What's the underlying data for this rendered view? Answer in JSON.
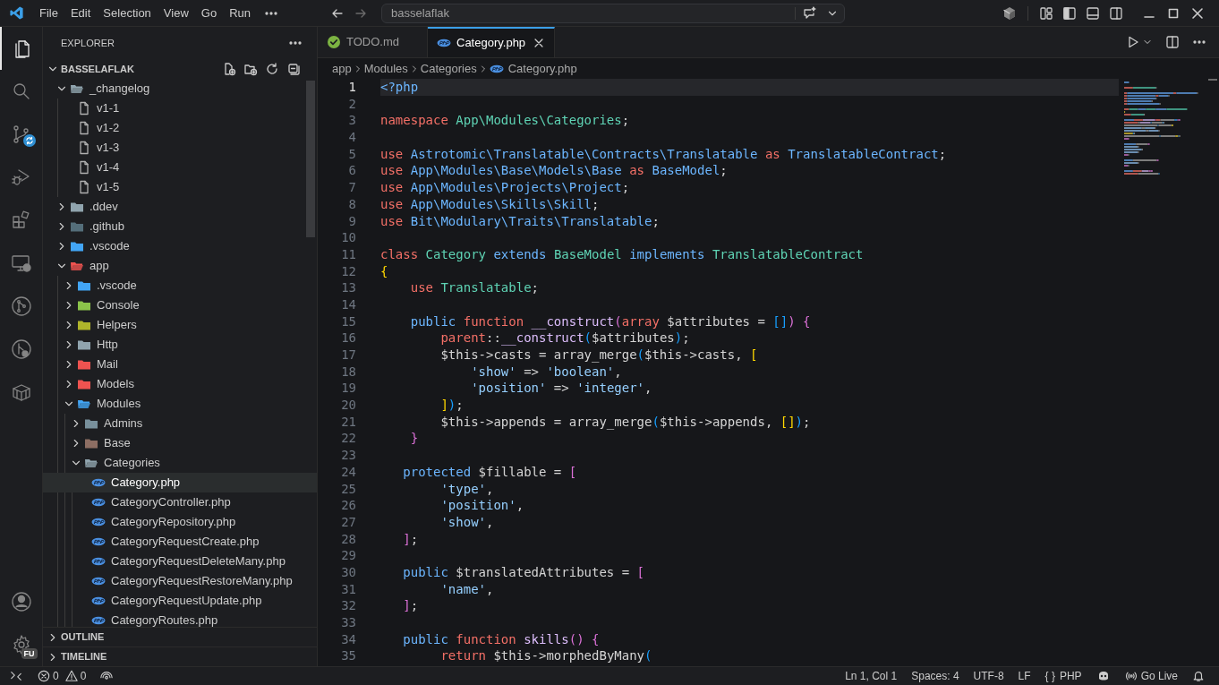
{
  "title_bar": {
    "menu": [
      "File",
      "Edit",
      "Selection",
      "View",
      "Go",
      "Run"
    ],
    "command_center": "basselaflak"
  },
  "activity_bar": {
    "items": [
      {
        "kind": "explorer",
        "selected": true
      },
      {
        "kind": "search",
        "selected": false
      },
      {
        "kind": "source-control",
        "selected": false
      },
      {
        "kind": "debug",
        "selected": false
      },
      {
        "kind": "extensions",
        "selected": false
      },
      {
        "kind": "remote",
        "selected": false
      },
      {
        "kind": "git-graph",
        "selected": false
      },
      {
        "kind": "git-tools",
        "selected": false
      },
      {
        "kind": "containers",
        "selected": false
      }
    ],
    "settings_badge": "FU"
  },
  "sidebar": {
    "title": "EXPLORER",
    "root": {
      "label": "BASSELAFLAK",
      "expanded": true
    },
    "tree": [
      {
        "label": "_changelog",
        "kind": "folder",
        "color": "#90a4ae",
        "expanded": true,
        "selected": false,
        "children": [
          {
            "label": "v1-1",
            "kind": "file",
            "selected": false
          },
          {
            "label": "v1-2",
            "kind": "file",
            "selected": false
          },
          {
            "label": "v1-3",
            "kind": "file",
            "selected": false
          },
          {
            "label": "v1-4",
            "kind": "file",
            "selected": false
          },
          {
            "label": "v1-5",
            "kind": "file",
            "selected": false
          }
        ]
      },
      {
        "label": ".ddev",
        "kind": "folder",
        "color": "#90a4ae",
        "expanded": false,
        "selected": false
      },
      {
        "label": ".github",
        "kind": "folder",
        "color": "#546e7a",
        "expanded": false,
        "selected": false
      },
      {
        "label": ".vscode",
        "kind": "folder",
        "color": "#42a5f5",
        "expanded": false,
        "selected": false
      },
      {
        "label": "app",
        "kind": "folder",
        "color": "#ef5350",
        "expanded": true,
        "selected": false,
        "children": [
          {
            "label": ".vscode",
            "kind": "folder",
            "color": "#42a5f5",
            "expanded": false,
            "selected": false
          },
          {
            "label": "Console",
            "kind": "folder",
            "color": "#8bc34a",
            "expanded": false,
            "selected": false
          },
          {
            "label": "Helpers",
            "kind": "folder",
            "color": "#afb42b",
            "expanded": false,
            "selected": false
          },
          {
            "label": "Http",
            "kind": "folder",
            "color": "#90a4ae",
            "expanded": false,
            "selected": false
          },
          {
            "label": "Mail",
            "kind": "folder",
            "color": "#ef5350",
            "expanded": false,
            "selected": false
          },
          {
            "label": "Models",
            "kind": "folder",
            "color": "#ef5350",
            "expanded": false,
            "selected": false
          },
          {
            "label": "Modules",
            "kind": "folder",
            "color": "#42a5f5",
            "expanded": true,
            "selected": false,
            "children": [
              {
                "label": "Admins",
                "kind": "folder",
                "color": "#78909c",
                "expanded": false,
                "selected": false
              },
              {
                "label": "Base",
                "kind": "folder",
                "color": "#8d6e63",
                "expanded": false,
                "selected": false
              },
              {
                "label": "Categories",
                "kind": "folder",
                "color": "#90a4ae",
                "expanded": true,
                "selected": false,
                "children": [
                  {
                    "label": "Category.php",
                    "kind": "php",
                    "selected": true
                  },
                  {
                    "label": "CategoryController.php",
                    "kind": "php",
                    "selected": false
                  },
                  {
                    "label": "CategoryRepository.php",
                    "kind": "php",
                    "selected": false
                  },
                  {
                    "label": "CategoryRequestCreate.php",
                    "kind": "php",
                    "selected": false
                  },
                  {
                    "label": "CategoryRequestDeleteMany.php",
                    "kind": "php",
                    "selected": false
                  },
                  {
                    "label": "CategoryRequestRestoreMany.php",
                    "kind": "php",
                    "selected": false
                  },
                  {
                    "label": "CategoryRequestUpdate.php",
                    "kind": "php",
                    "selected": false
                  },
                  {
                    "label": "CategoryRoutes.php",
                    "kind": "php",
                    "selected": false
                  }
                ]
              }
            ]
          }
        ]
      }
    ],
    "sections": [
      {
        "label": "OUTLINE",
        "expanded": false
      },
      {
        "label": "TIMELINE",
        "expanded": false
      }
    ]
  },
  "tabs": [
    {
      "label": "TODO.md",
      "kind": "markdown",
      "selected": false
    },
    {
      "label": "Category.php",
      "kind": "php",
      "selected": true
    }
  ],
  "breadcrumbs": [
    {
      "label": "app",
      "kind": "folder"
    },
    {
      "label": "Modules",
      "kind": "folder"
    },
    {
      "label": "Categories",
      "kind": "folder"
    },
    {
      "label": "Category.php",
      "kind": "php"
    }
  ],
  "editor": {
    "lines": [
      {
        "number": "1",
        "current": true,
        "tokens": [
          {
            "kind": "tag",
            "text": "<?php"
          }
        ]
      },
      {
        "number": "2",
        "current": false
      },
      {
        "number": "3",
        "current": false,
        "tokens": [
          {
            "kind": "kw",
            "text": "namespace"
          },
          {
            "kind": "ns",
            "text": " App\\Modules\\Categories"
          },
          {
            "kind": "plain",
            "text": ";"
          }
        ]
      },
      {
        "number": "4",
        "current": false
      },
      {
        "number": "5",
        "current": false,
        "tokens": [
          {
            "kind": "kw",
            "text": "use"
          },
          {
            "kind": "path",
            "text": " Astrotomic\\Translatable\\Contracts\\Translatable"
          },
          {
            "kind": "kw",
            "text": " as"
          },
          {
            "kind": "path",
            "text": " TranslatableContract"
          },
          {
            "kind": "plain",
            "text": ";"
          }
        ]
      },
      {
        "number": "6",
        "current": false,
        "tokens": [
          {
            "kind": "kw",
            "text": "use"
          },
          {
            "kind": "path",
            "text": " App\\Modules\\Base\\Models\\Base"
          },
          {
            "kind": "kw",
            "text": " as"
          },
          {
            "kind": "path",
            "text": " BaseModel"
          },
          {
            "kind": "plain",
            "text": ";"
          }
        ]
      },
      {
        "number": "7",
        "current": false,
        "tokens": [
          {
            "kind": "kw",
            "text": "use"
          },
          {
            "kind": "path",
            "text": " App\\Modules\\Projects\\Project"
          },
          {
            "kind": "plain",
            "text": ";"
          }
        ]
      },
      {
        "number": "8",
        "current": false,
        "tokens": [
          {
            "kind": "kw",
            "text": "use"
          },
          {
            "kind": "path",
            "text": " App\\Modules\\Skills\\Skill"
          },
          {
            "kind": "plain",
            "text": ";"
          }
        ]
      },
      {
        "number": "9",
        "current": false,
        "tokens": [
          {
            "kind": "kw",
            "text": "use"
          },
          {
            "kind": "path",
            "text": " Bit\\Modulary\\Traits\\Translatable"
          },
          {
            "kind": "plain",
            "text": ";"
          }
        ]
      },
      {
        "number": "10",
        "current": false
      },
      {
        "number": "11",
        "current": false,
        "tokens": [
          {
            "kind": "kw",
            "text": "class"
          },
          {
            "kind": "type",
            "text": " Category"
          },
          {
            "kind": "mod",
            "text": " extends"
          },
          {
            "kind": "type",
            "text": " BaseModel"
          },
          {
            "kind": "mod",
            "text": " implements"
          },
          {
            "kind": "type",
            "text": " TranslatableContract"
          }
        ]
      },
      {
        "number": "12",
        "current": false,
        "tokens": [
          {
            "kind": "b1",
            "text": "{"
          }
        ]
      },
      {
        "number": "13",
        "current": false,
        "tokens": [
          {
            "kind": "kw",
            "text": "    use"
          },
          {
            "kind": "type",
            "text": " Translatable"
          },
          {
            "kind": "plain",
            "text": ";"
          }
        ]
      },
      {
        "number": "14",
        "current": false
      },
      {
        "number": "15",
        "current": false,
        "tokens": [
          {
            "kind": "mod",
            "text": "    public"
          },
          {
            "kind": "kw",
            "text": " function"
          },
          {
            "kind": "fn",
            "text": " __construct"
          },
          {
            "kind": "b2",
            "text": "("
          },
          {
            "kind": "kw",
            "text": "array"
          },
          {
            "kind": "plain",
            "text": " $attributes ="
          },
          {
            "kind": "b3",
            "text": " []"
          },
          {
            "kind": "b2",
            "text": ")"
          },
          {
            "kind": "b2",
            "text": " {"
          }
        ]
      },
      {
        "number": "16",
        "current": false,
        "tokens": [
          {
            "kind": "kw",
            "text": "        parent"
          },
          {
            "kind": "plain",
            "text": "::"
          },
          {
            "kind": "fn",
            "text": "__construct"
          },
          {
            "kind": "b3",
            "text": "("
          },
          {
            "kind": "plain",
            "text": "$attributes"
          },
          {
            "kind": "b3",
            "text": ")"
          },
          {
            "kind": "plain",
            "text": ";"
          }
        ]
      },
      {
        "number": "17",
        "current": false,
        "tokens": [
          {
            "kind": "plain",
            "text": "        $this->casts = array_merge"
          },
          {
            "kind": "b3",
            "text": "("
          },
          {
            "kind": "plain",
            "text": "$this->casts,"
          },
          {
            "kind": "b1",
            "text": " ["
          }
        ]
      },
      {
        "number": "18",
        "current": false,
        "tokens": [
          {
            "kind": "str",
            "text": "            'show'"
          },
          {
            "kind": "plain",
            "text": " =>"
          },
          {
            "kind": "str",
            "text": " 'boolean'"
          },
          {
            "kind": "plain",
            "text": ","
          }
        ]
      },
      {
        "number": "19",
        "current": false,
        "tokens": [
          {
            "kind": "str",
            "text": "            'position'"
          },
          {
            "kind": "plain",
            "text": " =>"
          },
          {
            "kind": "str",
            "text": " 'integer'"
          },
          {
            "kind": "plain",
            "text": ","
          }
        ]
      },
      {
        "number": "20",
        "current": false,
        "tokens": [
          {
            "kind": "b1",
            "text": "        ]"
          },
          {
            "kind": "b3",
            "text": ")"
          },
          {
            "kind": "plain",
            "text": ";"
          }
        ]
      },
      {
        "number": "21",
        "current": false,
        "tokens": [
          {
            "kind": "plain",
            "text": "        $this->appends = array_merge"
          },
          {
            "kind": "b3",
            "text": "("
          },
          {
            "kind": "plain",
            "text": "$this->appends,"
          },
          {
            "kind": "b1",
            "text": " []"
          },
          {
            "kind": "b3",
            "text": ")"
          },
          {
            "kind": "plain",
            "text": ";"
          }
        ]
      },
      {
        "number": "22",
        "current": false,
        "tokens": [
          {
            "kind": "b2",
            "text": "    }"
          }
        ]
      },
      {
        "number": "23",
        "current": false
      },
      {
        "number": "24",
        "current": false,
        "tokens": [
          {
            "kind": "mod",
            "text": "   protected"
          },
          {
            "kind": "plain",
            "text": " $fillable ="
          },
          {
            "kind": "b2",
            "text": " ["
          }
        ]
      },
      {
        "number": "25",
        "current": false,
        "tokens": [
          {
            "kind": "str",
            "text": "        'type'"
          },
          {
            "kind": "plain",
            "text": ","
          }
        ]
      },
      {
        "number": "26",
        "current": false,
        "tokens": [
          {
            "kind": "str",
            "text": "        'position'"
          },
          {
            "kind": "plain",
            "text": ","
          }
        ]
      },
      {
        "number": "27",
        "current": false,
        "tokens": [
          {
            "kind": "str",
            "text": "        'show'"
          },
          {
            "kind": "plain",
            "text": ","
          }
        ]
      },
      {
        "number": "28",
        "current": false,
        "tokens": [
          {
            "kind": "b2",
            "text": "   ]"
          },
          {
            "kind": "plain",
            "text": ";"
          }
        ]
      },
      {
        "number": "29",
        "current": false
      },
      {
        "number": "30",
        "current": false,
        "tokens": [
          {
            "kind": "mod",
            "text": "   public"
          },
          {
            "kind": "plain",
            "text": " $translatedAttributes ="
          },
          {
            "kind": "b2",
            "text": " ["
          }
        ]
      },
      {
        "number": "31",
        "current": false,
        "tokens": [
          {
            "kind": "str",
            "text": "        'name'"
          },
          {
            "kind": "plain",
            "text": ","
          }
        ]
      },
      {
        "number": "32",
        "current": false,
        "tokens": [
          {
            "kind": "b2",
            "text": "   ]"
          },
          {
            "kind": "plain",
            "text": ";"
          }
        ]
      },
      {
        "number": "33",
        "current": false
      },
      {
        "number": "34",
        "current": false,
        "tokens": [
          {
            "kind": "mod",
            "text": "   public"
          },
          {
            "kind": "kw",
            "text": " function"
          },
          {
            "kind": "fn",
            "text": " skills"
          },
          {
            "kind": "b2",
            "text": "()"
          },
          {
            "kind": "b2",
            "text": " {"
          }
        ]
      },
      {
        "number": "35",
        "current": false,
        "tokens": [
          {
            "kind": "kw",
            "text": "        return"
          },
          {
            "kind": "plain",
            "text": " $this->morphedByMany"
          },
          {
            "kind": "b3",
            "text": "("
          }
        ]
      }
    ]
  },
  "status_bar": {
    "errors": "0",
    "warnings": "0",
    "position": "Ln 1, Col 1",
    "indentation": "Spaces: 4",
    "encoding": "UTF-8",
    "line_endings": "LF",
    "language_mark": "{ }",
    "language": "PHP",
    "live_server": "Go Live"
  }
}
